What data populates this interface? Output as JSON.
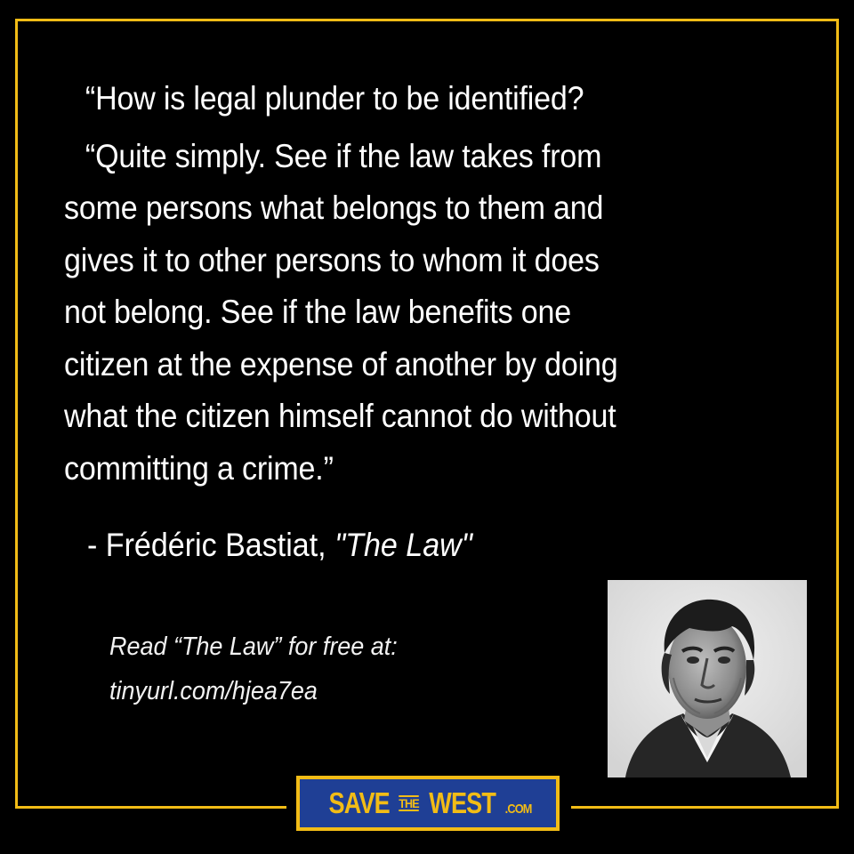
{
  "quote": {
    "question": "“How is legal plunder to be identified?",
    "answer_lines": [
      "“Quite simply. See if the law takes from",
      "some persons what belongs to them and",
      "gives it to other persons to whom it does",
      "not belong. See if the law benefits one",
      "citizen at the expense of another by doing",
      "what the citizen himself cannot do without",
      "committing a crime.”"
    ]
  },
  "attribution": {
    "prefix": "- Frédéric Bastiat, ",
    "work_title": "\"The Law\""
  },
  "read_more": {
    "line1": "Read “The Law” for free at:",
    "url": "tinyurl.com/hjea7ea"
  },
  "logo": {
    "save": "SAVE",
    "the": "THE",
    "west": "WEST",
    "com": ".COM"
  },
  "colors": {
    "background": "#000000",
    "frame": "#f2bc16",
    "text": "#ffffff",
    "logo_blue": "#1f3f95"
  }
}
